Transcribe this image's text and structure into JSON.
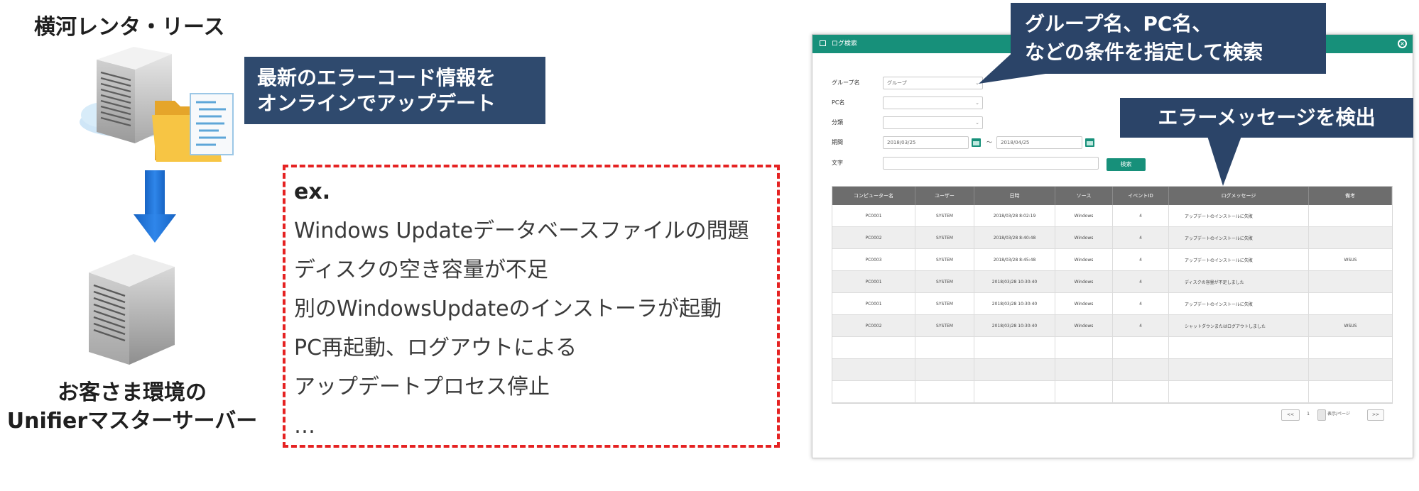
{
  "left": {
    "company_name": "横河レンタ・リース",
    "update_note": {
      "line1": "最新のエラーコード情報を",
      "line2": "オンラインでアップデート"
    },
    "customer_server": {
      "line1": "お客さま環境の",
      "line2": "Unifierマスターサーバー"
    },
    "icons": {
      "vendor_server": "server-tower-icon",
      "update_file": "folder-document-icon",
      "flow": "arrow-down-icon",
      "customer_server": "server-tower-icon"
    }
  },
  "examples": {
    "heading": "ex.",
    "items": [
      "Windows Updateデータベースファイルの問題",
      "ディスクの空き容量が不足",
      "別のWindowsUpdateのインストーラが起動",
      "PC再起動、ログアウトによる",
      "アップデートプロセス停止"
    ],
    "ellipsis": "…"
  },
  "callouts": {
    "search": {
      "line1": "グループ名、PC名、",
      "line2": "などの条件を指定して検索"
    },
    "detect": "エラーメッセージを検出"
  },
  "app": {
    "title": "ログ検索",
    "icons": {
      "title": "window-icon",
      "close": "close-circle-icon",
      "calendar": "calendar-icon",
      "dropdown": "chevron-down-icon"
    },
    "form": {
      "group": {
        "label": "グループ名",
        "value": "グループ"
      },
      "pc": {
        "label": "PC名"
      },
      "category": {
        "label": "分類"
      },
      "period": {
        "label": "期間",
        "from": "2018/03/25",
        "separator": "～",
        "to": "2018/04/25"
      },
      "keyword": {
        "label": "文字"
      },
      "search_button": "検索"
    },
    "table": {
      "headers": [
        "コンピューター名",
        "ユーザー",
        "日時",
        "ソース",
        "イベントID",
        "ログメッセージ",
        "備考"
      ],
      "rows": [
        [
          "PC0001",
          "SYSTEM",
          "2018/03/28 8:02:19",
          "Windows",
          "4",
          "アップデートのインストールに失敗",
          ""
        ],
        [
          "PC0002",
          "SYSTEM",
          "2018/03/28 8:40:48",
          "Windows",
          "4",
          "アップデートのインストールに失敗",
          ""
        ],
        [
          "PC0003",
          "SYSTEM",
          "2018/03/28 8:45:48",
          "Windows",
          "4",
          "アップデートのインストールに失敗",
          "WSUS"
        ],
        [
          "PC0001",
          "SYSTEM",
          "2018/03/28 10:30:40",
          "Windows",
          "4",
          "ディスクの容量が不足しました",
          ""
        ],
        [
          "PC0001",
          "SYSTEM",
          "2018/03/28 10:30:40",
          "Windows",
          "4",
          "アップデートのインストールに失敗",
          ""
        ],
        [
          "PC0002",
          "SYSTEM",
          "2018/03/28 10:30:40",
          "Windows",
          "4",
          "シャットダウンまたはログアウトしました",
          "WSUS"
        ]
      ]
    },
    "pagination": {
      "prev": "<<",
      "page": "1",
      "page_size": "表示/ページ",
      "next": ">>"
    }
  },
  "colors": {
    "navy_box": "#2f4a6e",
    "callout": "#2b4468",
    "dashed_border": "#e52222",
    "arrow": "#1e73d8",
    "app_accent": "#17907a",
    "table_header": "#6d6d6d"
  }
}
